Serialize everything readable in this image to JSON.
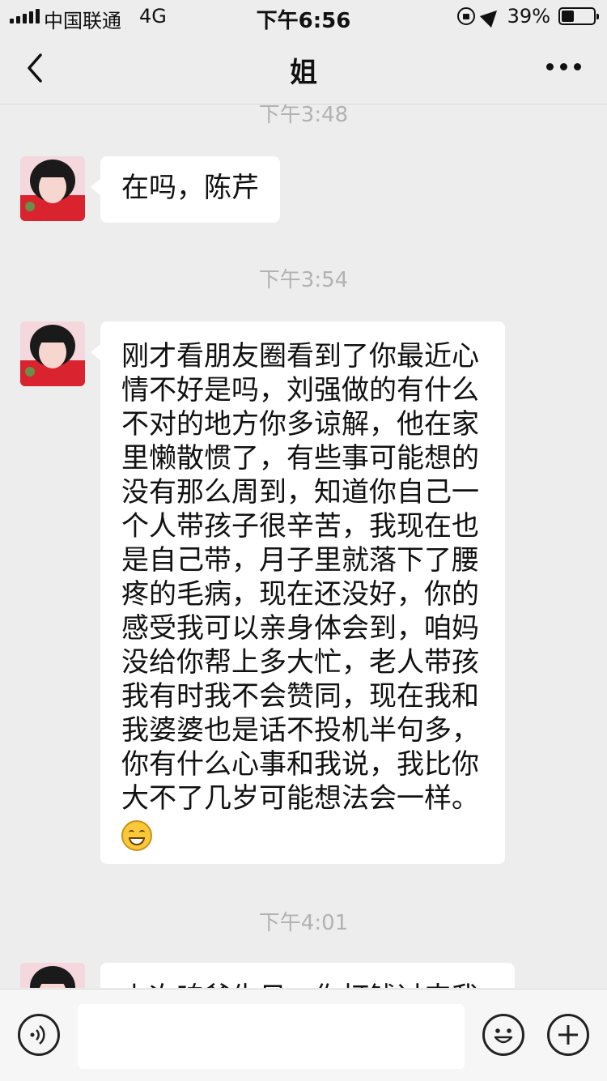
{
  "status_bar": {
    "carrier": "中国联通",
    "network": "4G",
    "time": "下午6:56",
    "battery_text": "39%",
    "battery_level": 0.39,
    "icons": [
      "signal-icon",
      "lock-rotation-icon",
      "location-icon",
      "battery-icon"
    ]
  },
  "nav": {
    "title": "姐",
    "icons": [
      "back-arrow-icon",
      "more-icon"
    ]
  },
  "messages": [
    {
      "timestamp": "下午3:48",
      "sender": "姐",
      "text": "在吗，陈芹"
    },
    {
      "timestamp": "下午3:54",
      "sender": "姐",
      "text": "刚才看朋友圈看到了你最近心情不好是吗，刘强做的有什么不对的地方你多谅解，他在家里懒散惯了，有些事可能想的没有那么周到，知道你自己一个人带孩子很辛苦，我现在也是自己带，月子里就落下了腰疼的毛病，现在还没好，你的感受我可以亲身体会到，咱妈没给你帮上多大忙，老人带孩我有时我不会赞同，现在我和我婆婆也是话不投机半句多，你有什么心事和我说，我比你大不了几岁可能想法会一样。",
      "emoji": "grin-emoji"
    },
    {
      "timestamp": "下午4:01",
      "sender": "姐",
      "text": "上次咱爸生日，你打钱过来我"
    }
  ],
  "input_bar": {
    "value": "",
    "icons": [
      "voice-icon",
      "emoji-icon",
      "plus-icon"
    ]
  },
  "colors": {
    "background": "#ededed",
    "bubble": "#ffffff",
    "timestamp": "#b2b2b2"
  }
}
